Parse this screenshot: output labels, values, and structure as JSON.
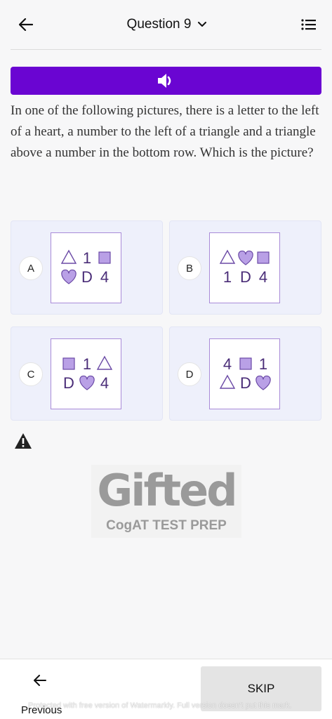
{
  "header": {
    "title": "Question 9"
  },
  "question": {
    "text": "In one of the following pictures, there is a letter to the left of a heart, a number to the left of a triangle and a triangle above a number in the bottom row. Which is the picture?"
  },
  "options": [
    {
      "label": "A",
      "rows": [
        [
          "triangle",
          "1",
          "square"
        ],
        [
          "heart",
          "D",
          "4"
        ]
      ]
    },
    {
      "label": "B",
      "rows": [
        [
          "triangle",
          "heart",
          "square"
        ],
        [
          "1",
          "D",
          "4"
        ]
      ]
    },
    {
      "label": "C",
      "rows": [
        [
          "square",
          "1",
          "triangle"
        ],
        [
          "D",
          "heart",
          "4"
        ]
      ]
    },
    {
      "label": "D",
      "rows": [
        [
          "4",
          "square",
          "1"
        ],
        [
          "triangle",
          "D",
          "heart"
        ]
      ]
    }
  ],
  "colors": {
    "accent": "#6a05d2",
    "shape_fill": "#b9a0e6",
    "shape_stroke": "#6b4aa6",
    "glyph": "#4a2d78"
  },
  "logo": {
    "main": "Gifted",
    "sub": "CogAT TEST PREP"
  },
  "footer": {
    "previous_label": "Previous",
    "skip_label": "SKIP",
    "watermark": "Protected with free version of Watermarkly. Full version doesn't put this mark."
  }
}
